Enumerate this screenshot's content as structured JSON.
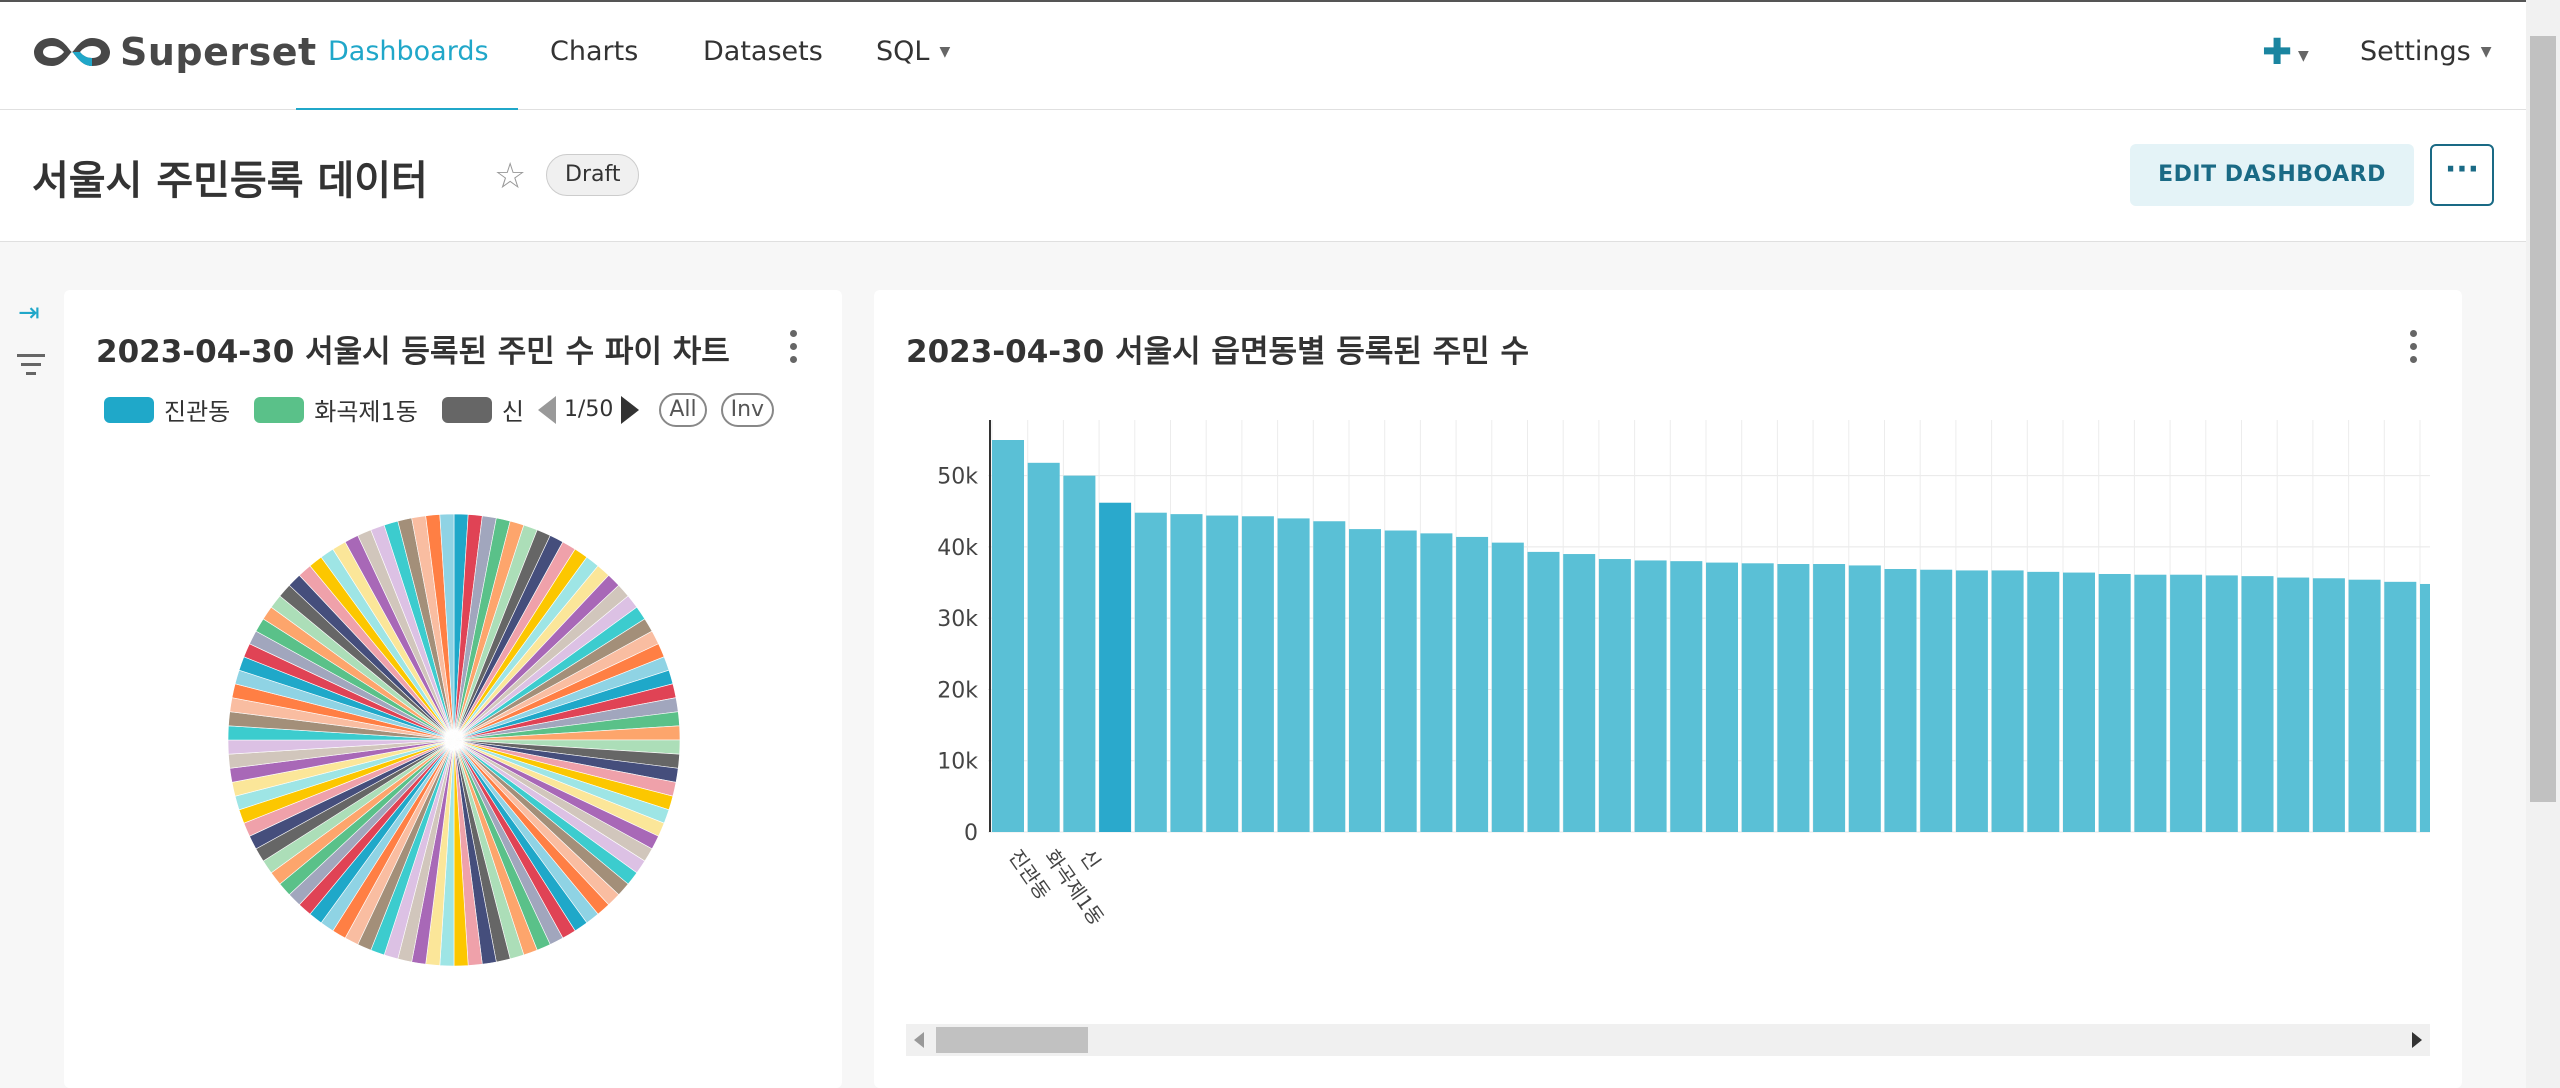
{
  "app": {
    "brand": "Superset",
    "nav": {
      "dashboards": "Dashboards",
      "charts": "Charts",
      "datasets": "Datasets",
      "sql": "SQL",
      "settings": "Settings"
    }
  },
  "header": {
    "title": "서울시 주민등록 데이터",
    "status_badge": "Draft",
    "edit_button": "EDIT DASHBOARD",
    "more_button": "···"
  },
  "colors": {
    "accent": "#20a7c9",
    "bar": "#5ac0d6",
    "bar_highlight": "#2aa9cc",
    "pie": [
      "#1fa8c9",
      "#5ac189",
      "#666666",
      "#fcc700",
      "#a868b7",
      "#3cccce",
      "#ff7f44",
      "#e04355",
      "#fda56c",
      "#454e7c",
      "#9ee5e5",
      "#d1c6bc",
      "#a38f79",
      "#8fd3e4",
      "#a1a6bd",
      "#acdeb8",
      "#efa1aa",
      "#fbe699",
      "#dcc1e4",
      "#f9bda1"
    ]
  },
  "pie_card": {
    "title": "2023-04-30 서울시 등록된 주민 수 파이 차트",
    "legend": [
      {
        "label": "진관동",
        "color": "#1fa8c9"
      },
      {
        "label": "화곡제1동",
        "color": "#5ac189"
      },
      {
        "label": "신",
        "color": "#666666"
      }
    ],
    "legend_page": "1/50",
    "legend_all": "All",
    "legend_inv": "Inv"
  },
  "bar_card": {
    "title": "2023-04-30 서울시 읍면동별 등록된 주민 수"
  },
  "chart_data": [
    {
      "type": "pie",
      "title": "2023-04-30 서울시 등록된 주민 수 파이 차트",
      "legend_visible": [
        "진관동",
        "화곡제1동",
        "신"
      ],
      "slice_count": 100
    },
    {
      "type": "bar",
      "title": "2023-04-30 서울시 읍면동별 등록된 주민 수",
      "yticks": [
        "0",
        "10k",
        "20k",
        "30k",
        "40k",
        "50k"
      ],
      "ylim": [
        0,
        55000
      ],
      "grid": true,
      "categories": [
        "진관동",
        "화곡제1동",
        "신",
        "",
        "",
        "",
        "",
        "",
        "",
        "",
        "",
        "",
        "",
        "",
        "",
        "",
        "",
        "",
        "",
        "",
        "",
        "",
        "",
        "",
        "",
        "",
        "",
        "",
        "",
        "",
        "",
        "",
        "",
        "",
        "",
        "",
        "",
        "",
        "",
        "",
        ""
      ],
      "values": [
        55000,
        51800,
        50000,
        46200,
        44800,
        44600,
        44400,
        44300,
        44000,
        43600,
        42500,
        42300,
        41900,
        41400,
        40600,
        39300,
        39000,
        38300,
        38100,
        38000,
        37800,
        37700,
        37600,
        37600,
        37400,
        36900,
        36800,
        36700,
        36700,
        36500,
        36400,
        36200,
        36100,
        36100,
        36000,
        35900,
        35700,
        35600,
        35400,
        35100,
        34800
      ]
    }
  ]
}
